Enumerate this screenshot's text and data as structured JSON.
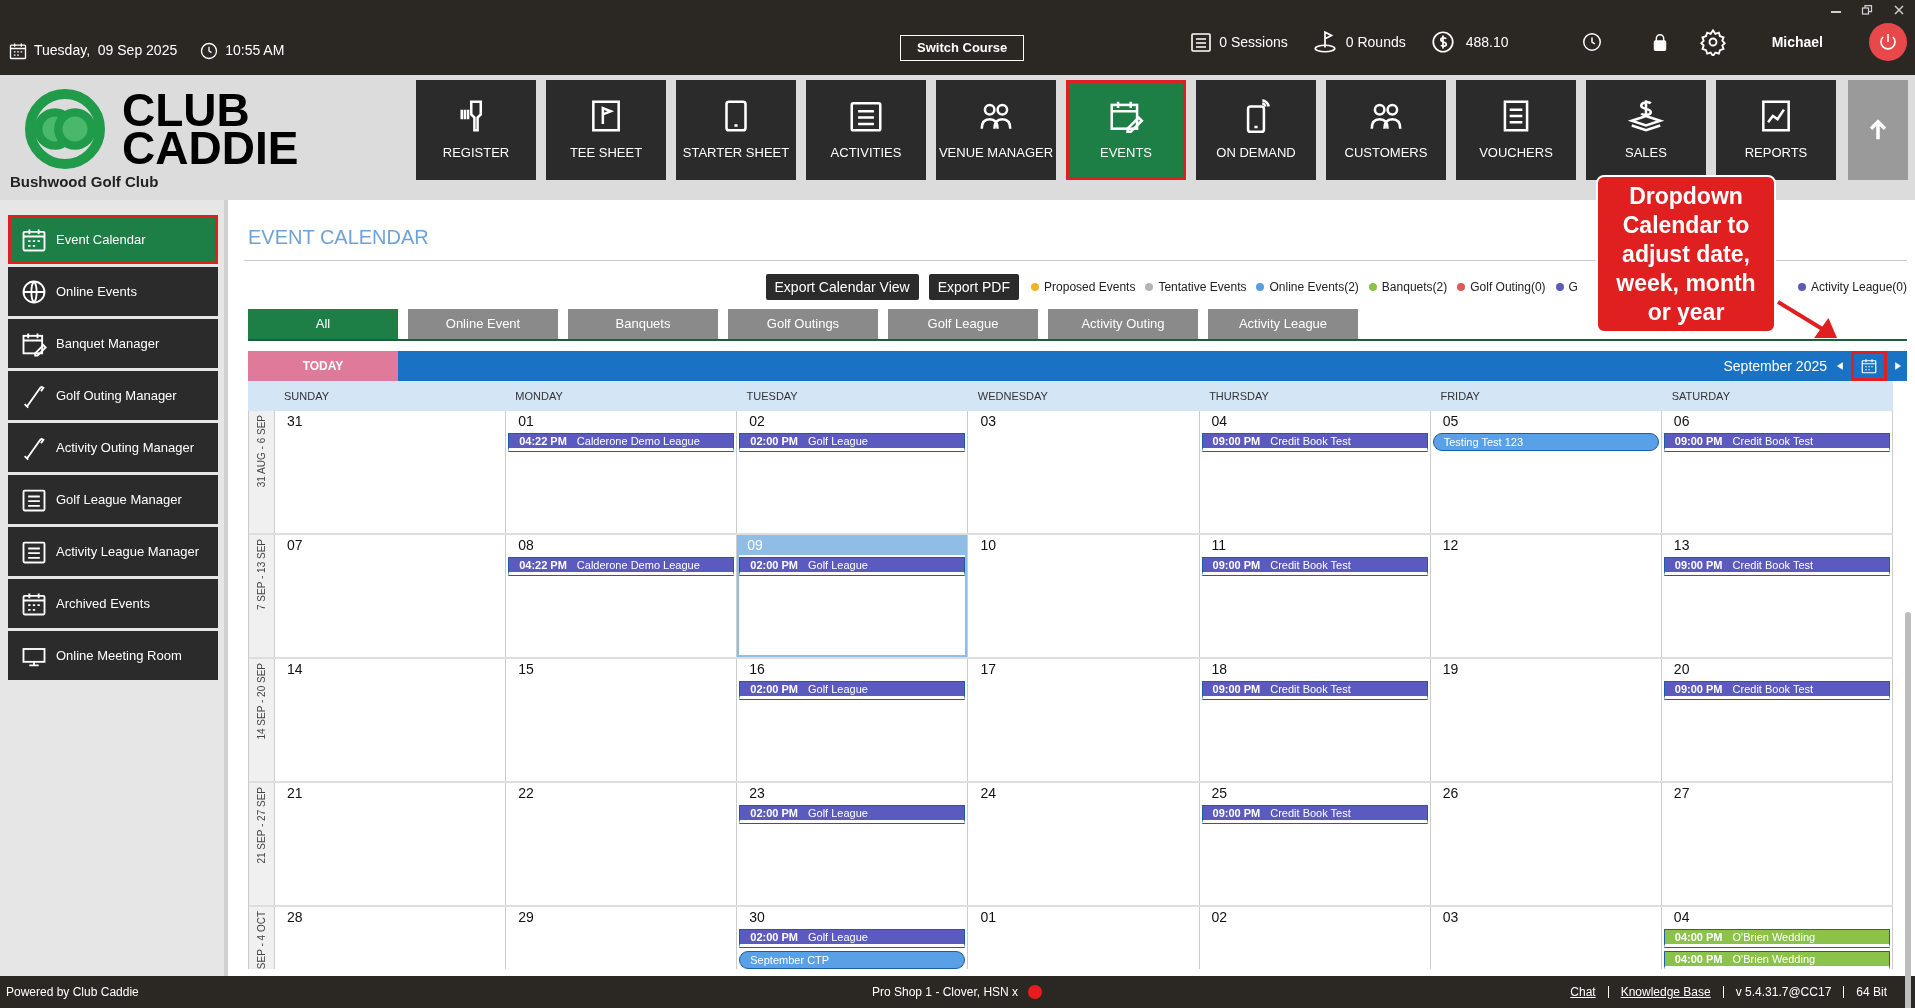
{
  "top_bar": {
    "date": "Tuesday,  09 Sep 2025",
    "time": "10:55 AM",
    "switch_button": "Switch Course",
    "sessions": "0 Sessions",
    "rounds": "0 Rounds",
    "balance": "488.10",
    "user": "Michael"
  },
  "logo": {
    "line_1": "CLUB",
    "line_2": "CADDIE",
    "club_name": "Bushwood Golf Club"
  },
  "nav": [
    {
      "label": "REGISTER",
      "selected": false
    },
    {
      "label": "TEE SHEET",
      "selected": false
    },
    {
      "label": "STARTER SHEET",
      "selected": false
    },
    {
      "label": "ACTIVITIES",
      "selected": false
    },
    {
      "label": "VENUE MANAGER",
      "selected": false
    },
    {
      "label": "EVENTS",
      "selected": true
    },
    {
      "label": "ON DEMAND",
      "selected": false
    },
    {
      "label": "CUSTOMERS",
      "selected": false
    },
    {
      "label": "VOUCHERS",
      "selected": false
    },
    {
      "label": "SALES",
      "selected": false
    },
    {
      "label": "REPORTS",
      "selected": false
    }
  ],
  "sidebar": [
    {
      "label": "Event Calendar",
      "selected": true
    },
    {
      "label": "Online Events",
      "selected": false
    },
    {
      "label": "Banquet Manager",
      "selected": false
    },
    {
      "label": "Golf Outing Manager",
      "selected": false
    },
    {
      "label": "Activity Outing Manager",
      "selected": false
    },
    {
      "label": "Golf League Manager",
      "selected": false
    },
    {
      "label": "Activity League Manager",
      "selected": false
    },
    {
      "label": "Archived Events",
      "selected": false
    },
    {
      "label": "Online Meeting Room",
      "selected": false
    }
  ],
  "page_title": "EVENT CALENDAR",
  "export_buttons": [
    "Export Calendar View",
    "Export PDF"
  ],
  "legend": [
    {
      "label": "Proposed Events",
      "color": "#f0b429"
    },
    {
      "label": "Tentative Events",
      "color": "#b5b5b5"
    },
    {
      "label": "Online Events(2)",
      "color": "#5b9be0"
    },
    {
      "label": "Banquets(2)",
      "color": "#8bc34a"
    },
    {
      "label": "Golf Outing(0)",
      "color": "#e05a5a"
    },
    {
      "label": "G",
      "color": "#5b5bb8"
    },
    {
      "label": "Activity League(0)",
      "color": "#5b5bb8"
    }
  ],
  "category_tabs": [
    {
      "label": "All",
      "selected": true
    },
    {
      "label": "Online Event",
      "selected": false
    },
    {
      "label": "Banquets",
      "selected": false
    },
    {
      "label": "Golf Outings",
      "selected": false
    },
    {
      "label": "Golf League",
      "selected": false
    },
    {
      "label": "Activity Outing",
      "selected": false
    },
    {
      "label": "Activity League",
      "selected": false
    }
  ],
  "today_button": "TODAY",
  "month_label": "September 2025",
  "weekdays": [
    "SUNDAY",
    "MONDAY",
    "TUESDAY",
    "WEDNESDAY",
    "THURSDAY",
    "FRIDAY",
    "SATURDAY"
  ],
  "weeks": [
    {
      "label": "31 AUG - 6 SEP",
      "days": [
        {
          "day": "31",
          "today": false
        },
        {
          "day": "01",
          "today": false,
          "events": [
            {
              "time": "04:22 PM",
              "title": "Calderone Demo League",
              "color": "#5b5bbf"
            }
          ]
        },
        {
          "day": "02",
          "today": false,
          "events": [
            {
              "time": "02:00 PM",
              "title": "Golf League",
              "color": "#5b5bbf"
            }
          ]
        },
        {
          "day": "03",
          "today": false
        },
        {
          "day": "04",
          "today": false,
          "events": [
            {
              "time": "09:00 PM",
              "title": "Credit Book Test",
              "color": "#5b5bbf"
            }
          ]
        },
        {
          "day": "05",
          "today": false,
          "events": [
            {
              "title": "Testing Test 123",
              "color": "#5aa0e6"
            }
          ]
        },
        {
          "day": "06",
          "today": false,
          "events": [
            {
              "time": "09:00 PM",
              "title": "Credit Book Test",
              "color": "#5b5bbf"
            }
          ]
        }
      ]
    },
    {
      "label": "7 SEP - 13 SEP",
      "days": [
        {
          "day": "07",
          "today": false
        },
        {
          "day": "08",
          "today": false,
          "events": [
            {
              "time": "04:22 PM",
              "title": "Calderone Demo League",
              "color": "#5b5bbf"
            }
          ]
        },
        {
          "day": "09",
          "today": true,
          "events": [
            {
              "time": "02:00 PM",
              "title": "Golf League",
              "color": "#5b5bbf"
            }
          ]
        },
        {
          "day": "10",
          "today": false
        },
        {
          "day": "11",
          "today": false,
          "events": [
            {
              "time": "09:00 PM",
              "title": "Credit Book Test",
              "color": "#5b5bbf"
            }
          ]
        },
        {
          "day": "12",
          "today": false
        },
        {
          "day": "13",
          "today": false,
          "events": [
            {
              "time": "09:00 PM",
              "title": "Credit Book Test",
              "color": "#5b5bbf"
            }
          ]
        }
      ]
    },
    {
      "label": "14 SEP - 20 SEP",
      "days": [
        {
          "day": "14",
          "today": false
        },
        {
          "day": "15",
          "today": false
        },
        {
          "day": "16",
          "today": false,
          "events": [
            {
              "time": "02:00 PM",
              "title": "Golf League",
              "color": "#5b5bbf"
            }
          ]
        },
        {
          "day": "17",
          "today": false
        },
        {
          "day": "18",
          "today": false,
          "events": [
            {
              "time": "09:00 PM",
              "title": "Credit Book Test",
              "color": "#5b5bbf"
            }
          ]
        },
        {
          "day": "19",
          "today": false
        },
        {
          "day": "20",
          "today": false,
          "events": [
            {
              "time": "09:00 PM",
              "title": "Credit Book Test",
              "color": "#5b5bbf"
            }
          ]
        }
      ]
    },
    {
      "label": "21 SEP - 27 SEP",
      "days": [
        {
          "day": "21",
          "today": false
        },
        {
          "day": "22",
          "today": false
        },
        {
          "day": "23",
          "today": false,
          "events": [
            {
              "time": "02:00 PM",
              "title": "Golf League",
              "color": "#5b5bbf"
            }
          ]
        },
        {
          "day": "24",
          "today": false
        },
        {
          "day": "25",
          "today": false,
          "events": [
            {
              "time": "09:00 PM",
              "title": "Credit Book Test",
              "color": "#5b5bbf"
            }
          ]
        },
        {
          "day": "26",
          "today": false
        },
        {
          "day": "27",
          "today": false
        }
      ]
    },
    {
      "label": "SEP - 4 OCT",
      "days": [
        {
          "day": "28",
          "today": false
        },
        {
          "day": "29",
          "today": false
        },
        {
          "day": "30",
          "today": false,
          "events": [
            {
              "time": "02:00 PM",
              "title": "Golf League",
              "color": "#5b5bbf"
            },
            {
              "title": "September CTP",
              "color": "#5aa0e6"
            }
          ]
        },
        {
          "day": "01",
          "today": false
        },
        {
          "day": "02",
          "today": false
        },
        {
          "day": "03",
          "today": false
        },
        {
          "day": "04",
          "today": false,
          "events": [
            {
              "time": "04:00 PM",
              "title": "O'Brien Wedding",
              "color": "#8bc34a"
            },
            {
              "time": "04:00 PM",
              "title": "O'Brien Wedding",
              "color": "#8bc34a"
            }
          ]
        }
      ]
    }
  ],
  "callout": "Dropdown Calendar to adjust date, week, month or year",
  "footer": {
    "powered_by": "Powered by Club Caddie",
    "station": "Pro Shop 1 - Clover, HSN x",
    "links": [
      "Chat",
      "Knowledge Base"
    ],
    "version": "v 5.4.31.7@CC17",
    "bits": "64 Bit"
  }
}
